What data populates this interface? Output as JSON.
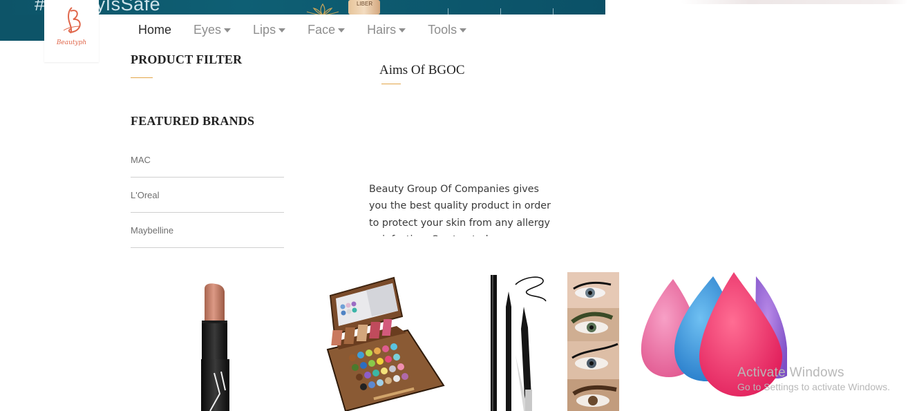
{
  "banner": {
    "hashtag_text": "#BeautyIsSafe",
    "tube_label": "LIBER"
  },
  "logo": {
    "wordmark": "Beautyph",
    "letter": "B"
  },
  "nav": {
    "items": [
      {
        "label": "Home",
        "dropdown": false,
        "active": true
      },
      {
        "label": "Eyes",
        "dropdown": true,
        "active": false
      },
      {
        "label": "Lips",
        "dropdown": true,
        "active": false
      },
      {
        "label": "Face",
        "dropdown": true,
        "active": false
      },
      {
        "label": "Hairs",
        "dropdown": true,
        "active": false
      },
      {
        "label": "Tools",
        "dropdown": true,
        "active": false
      }
    ]
  },
  "sidebar": {
    "product_filter_heading": "PRODUCT FILTER",
    "featured_brands_heading": "FEATURED BRANDS",
    "brands": [
      "MAC",
      "L'Oreal",
      "Maybelline"
    ]
  },
  "aims": {
    "title": "Aims Of BGOC",
    "text": "Beauty Group Of Companies gives you the best quality product in order to protect your skin from any allergy or infection. Our trusted"
  },
  "products": [
    {
      "name": "lipstick",
      "icon": "lipstick-image"
    },
    {
      "name": "eyeshadow-palette",
      "icon": "palette-image"
    },
    {
      "name": "eyeliner",
      "icon": "eyeliner-image"
    },
    {
      "name": "beauty-blender",
      "icon": "sponge-image"
    }
  ],
  "watermark": {
    "title": "Activate Windows",
    "subtitle": "Go to Settings to activate Windows."
  },
  "colors": {
    "accent_underline": "#e2a548",
    "banner_bg": "#0d5468",
    "logo_color": "#e0664a"
  }
}
